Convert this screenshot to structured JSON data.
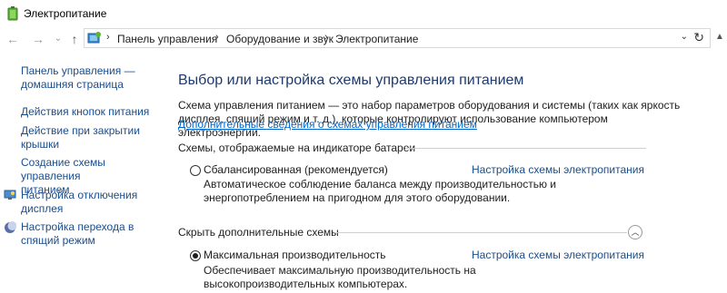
{
  "window": {
    "title": "Электропитание",
    "icon": "battery-icon"
  },
  "navigation": {
    "back_icon": "back-arrow-icon",
    "forward_icon": "forward-arrow-icon",
    "up_icon": "up-arrow-icon",
    "breadcrumbs": [
      "Панель управления",
      "Оборудование и звук",
      "Электропитание"
    ],
    "separator": "›",
    "dropdown_glyph": "⌄",
    "refresh_glyph": "↻"
  },
  "sidebar": {
    "items": [
      {
        "label_line1": "Панель управления —",
        "label_line2": "домашняя страница",
        "icon": null
      },
      {
        "label_line1": "Действия кнопок питания",
        "label_line2": "",
        "icon": null
      },
      {
        "label_line1": "Действие при закрытии",
        "label_line2": "крышки",
        "icon": null
      },
      {
        "label_line1": "Создание схемы управления",
        "label_line2": "питанием",
        "icon": null
      },
      {
        "label_line1": "Настройка отключения",
        "label_line2": "дисплея",
        "icon": "display-icon"
      },
      {
        "label_line1": "Настройка перехода в",
        "label_line2": "спящий режим",
        "icon": "moon-icon"
      }
    ]
  },
  "main": {
    "heading": "Выбор или настройка схемы управления питанием",
    "description": "Схема управления питанием — это набор параметров оборудования и системы (таких как яркость дисплея, спящий режим и т. д.), которые контролируют использование компьютером электроэнергии.",
    "more_link": "Дополнительные сведения о схемах управления питанием",
    "battery_section": {
      "title": "Схемы, отображаемые на индикаторе батареи",
      "plans": [
        {
          "name": "Сбалансированная (рекомендуется)",
          "selected": false,
          "settings_link": "Настройка схемы электропитания",
          "description": "Автоматическое соблюдение баланса между производительностью и энергопотреблением на пригодном для этого оборудовании."
        }
      ]
    },
    "hidden_section": {
      "title": "Скрыть дополнительные схемы",
      "collapse_glyph": "︿",
      "plans": [
        {
          "name": "Максимальная производительность",
          "selected": true,
          "settings_link": "Настройка схемы электропитания",
          "description": "Обеспечивает максимальную производительность на высокопроизводительных компьютерах."
        }
      ]
    }
  },
  "colors": {
    "link": "#1a4d8c",
    "heading": "#1e3a6e",
    "hyperlink": "#0066cc"
  }
}
